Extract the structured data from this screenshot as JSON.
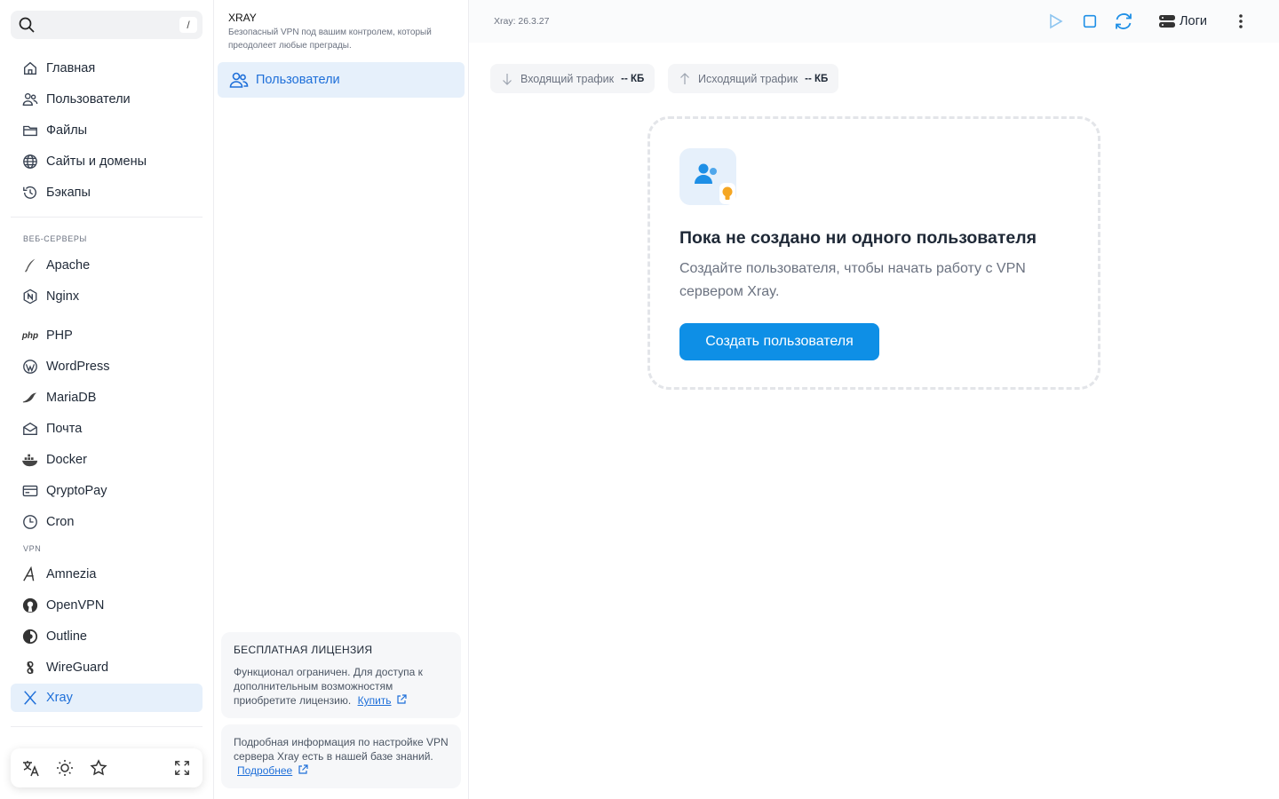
{
  "sidebar": {
    "search": {
      "shortcut": "/"
    },
    "items": [
      {
        "label": "Главная",
        "icon": "home-icon"
      },
      {
        "label": "Пользователи",
        "icon": "users-icon"
      },
      {
        "label": "Файлы",
        "icon": "folder-icon"
      },
      {
        "label": "Сайты и домены",
        "icon": "globe-icon"
      },
      {
        "label": "Бэкапы",
        "icon": "history-icon"
      }
    ],
    "web_section_label": "ВЕБ-СЕРВЕРЫ",
    "web_items": [
      {
        "label": "Apache",
        "icon": "apache-feather-icon"
      },
      {
        "label": "Nginx",
        "icon": "nginx-icon"
      },
      {
        "label": "PHP",
        "icon": "php-icon"
      },
      {
        "label": "WordPress",
        "icon": "wordpress-icon"
      },
      {
        "label": "MariaDB",
        "icon": "mariadb-seal-icon"
      },
      {
        "label": "Почта",
        "icon": "mail-icon"
      },
      {
        "label": "Docker",
        "icon": "docker-icon"
      },
      {
        "label": "QryptoPay",
        "icon": "card-icon"
      },
      {
        "label": "Cron",
        "icon": "clock-icon"
      }
    ],
    "vpn_section_label": "VPN",
    "vpn_items": [
      {
        "label": "Amnezia",
        "icon": "amnezia-icon"
      },
      {
        "label": "OpenVPN",
        "icon": "openvpn-icon"
      },
      {
        "label": "Outline",
        "icon": "outline-icon"
      },
      {
        "label": "WireGuard",
        "icon": "wireguard-icon"
      },
      {
        "label": "Xray",
        "icon": "xray-icon",
        "active": true
      }
    ]
  },
  "panel": {
    "title": "XRAY",
    "description": "Безопасный VPN под вашим контролем, который преодолеет любые преграды.",
    "item_label": "Пользователи",
    "license": {
      "heading": "БЕСПЛАТНАЯ ЛИЦЕНЗИЯ",
      "text": "Функционал ограничен. Для доступа к дополнительным возможностям приобретите лицензию.",
      "link": "Купить"
    },
    "help": {
      "text": "Подробная информация по настройке VPN сервера Xray есть в нашей базе знаний.",
      "link": "Подробнее"
    }
  },
  "topbar": {
    "version": "Xray: 26.3.27",
    "logs_label": "Логи"
  },
  "traffic": {
    "incoming_label": "Входящий трафик",
    "incoming_value": "-- КБ",
    "outgoing_label": "Исходящий трафик",
    "outgoing_value": "-- КБ"
  },
  "empty_state": {
    "title": "Пока не создано ни одного пользователя",
    "description": "Создайте пользователя, чтобы начать работу с VPN сервером Xray.",
    "button": "Создать пользователя"
  },
  "colors": {
    "accent": "#0e8fe6",
    "active_bg": "#e6f0fb",
    "active_text": "#1e6fd9",
    "bulb": "#f5a623"
  }
}
